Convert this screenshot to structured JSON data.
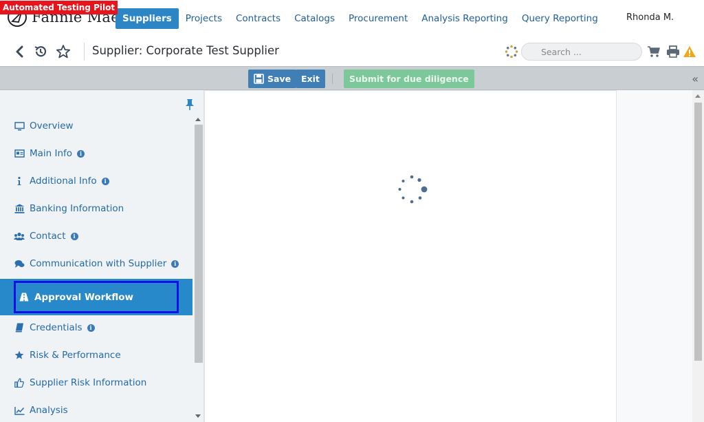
{
  "testing_badge": "Automated Testing Pilot",
  "brand": {
    "name": "Fannie Mae",
    "trademark": "™"
  },
  "nav": {
    "tabs": [
      {
        "label": "Suppliers",
        "active": true
      },
      {
        "label": "Projects",
        "active": false
      },
      {
        "label": "Contracts",
        "active": false
      },
      {
        "label": "Catalogs",
        "active": false
      },
      {
        "label": "Procurement",
        "active": false
      },
      {
        "label": "Analysis Reporting",
        "active": false
      },
      {
        "label": "Query Reporting",
        "active": false
      }
    ],
    "user": "Rhonda M."
  },
  "header": {
    "title": "Supplier: Corporate Test Supplier",
    "search_placeholder": "Search ...",
    "icons": [
      "back-icon",
      "history-icon",
      "star-icon",
      "loading-dots-icon",
      "cart-icon",
      "print-icon",
      "warning-icon"
    ]
  },
  "toolbar": {
    "save_label": "Save",
    "exit_label": "Exit",
    "submit_label": "Submit for due diligence",
    "collapse_label": "«"
  },
  "sidebar": {
    "items": [
      {
        "label": "Overview",
        "icon": "monitor-icon",
        "info": false,
        "active": false
      },
      {
        "label": "Main Info",
        "icon": "id-card-icon",
        "info": true,
        "active": false
      },
      {
        "label": "Additional Info",
        "icon": "info-letter-icon",
        "info": true,
        "active": false
      },
      {
        "label": "Banking Information",
        "icon": "bank-icon",
        "info": false,
        "active": false
      },
      {
        "label": "Contact",
        "icon": "users-icon",
        "info": true,
        "active": false
      },
      {
        "label": "Communication with Supplier",
        "icon": "chat-icon",
        "info": true,
        "active": false
      },
      {
        "label": "Approval Workflow",
        "icon": "road-icon",
        "info": false,
        "active": true
      },
      {
        "label": "Credentials",
        "icon": "book-icon",
        "info": true,
        "active": false
      },
      {
        "label": "Risk & Performance",
        "icon": "star-icon",
        "info": false,
        "active": false
      },
      {
        "label": "Supplier Risk Information",
        "icon": "thumbs-up-icon",
        "info": false,
        "active": false
      },
      {
        "label": "Analysis",
        "icon": "line-chart-icon",
        "info": false,
        "active": false
      }
    ]
  },
  "colors": {
    "brand_blue": "#2c86c6",
    "link_blue": "#236aa6",
    "toolbar_bg": "#c9ced3",
    "submit_green": "#7cc89a",
    "highlight_border": "#0b10e8",
    "badge_red": "#e8141c",
    "warning_orange": "#f0a81a"
  }
}
